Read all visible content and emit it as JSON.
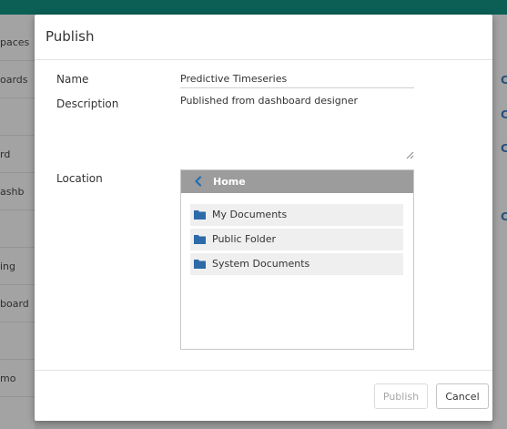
{
  "background": {
    "sidebar_items": [
      "paces",
      "oards",
      "",
      "rd",
      "ashb",
      "",
      "ing",
      "board",
      "",
      "mo"
    ],
    "right_glyphs": [
      "C",
      "C",
      "C",
      "C"
    ]
  },
  "dialog": {
    "title": "Publish",
    "fields": {
      "name_label": "Name",
      "name_value": "Predictive Timeseries",
      "description_label": "Description",
      "description_value": "Published from dashboard designer",
      "location_label": "Location"
    },
    "location_browser": {
      "current_folder": "Home",
      "folders": [
        "My Documents",
        "Public Folder",
        "System Documents"
      ]
    },
    "buttons": {
      "publish": "Publish",
      "cancel": "Cancel"
    }
  },
  "colors": {
    "topbar": "#0b5f55",
    "folder_icon": "#2c6aa8",
    "browser_header": "#9c9c9c"
  },
  "icons": [
    "chevron-left-icon",
    "folder-icon",
    "resize-handle-icon"
  ]
}
